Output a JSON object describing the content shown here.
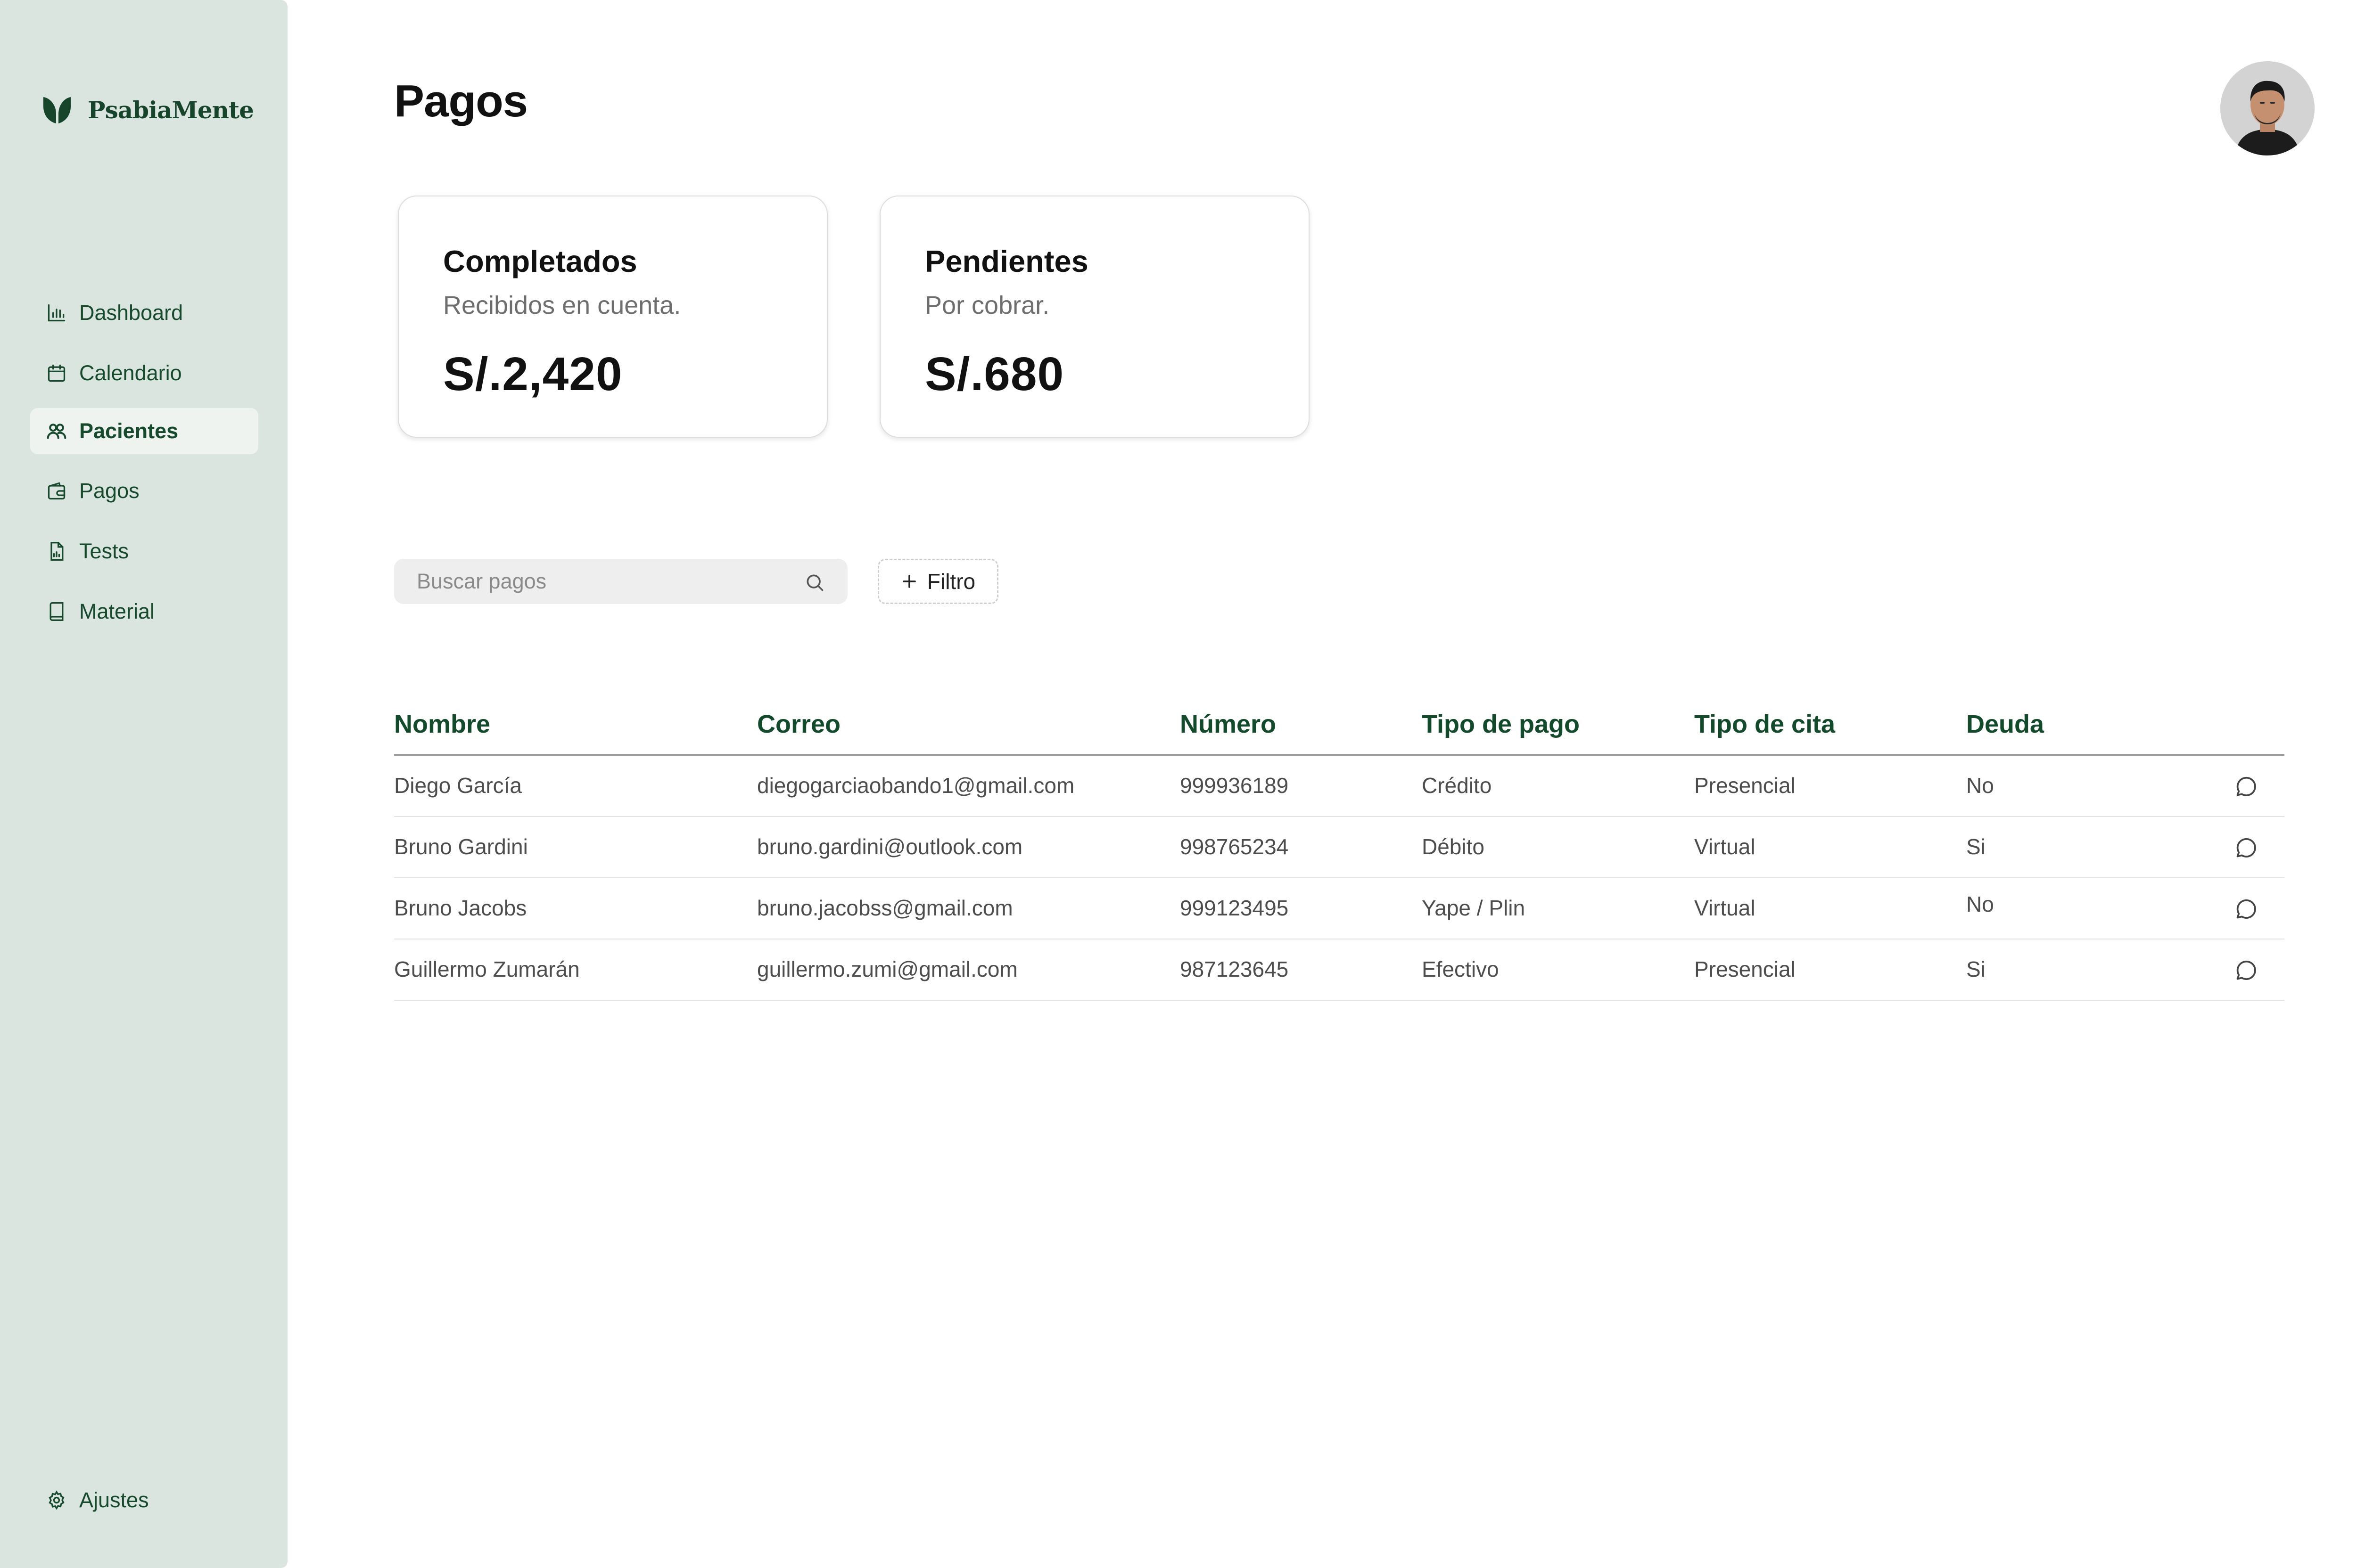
{
  "app": {
    "brand": "PsabiaMente",
    "brand_color": "#17452c",
    "sidebar_bg": "#dbe5df"
  },
  "sidebar": {
    "items": [
      {
        "label": "Dashboard",
        "icon": "bar-chart-icon"
      },
      {
        "label": "Calendario",
        "icon": "calendar-icon"
      },
      {
        "label": "Pacientes",
        "icon": "users-icon",
        "active": true
      },
      {
        "label": "Pagos",
        "icon": "wallet-icon"
      },
      {
        "label": "Tests",
        "icon": "document-chart-icon"
      },
      {
        "label": "Material",
        "icon": "book-icon"
      }
    ],
    "settings": {
      "label": "Ajustes",
      "icon": "gear-icon"
    }
  },
  "page": {
    "title": "Pagos"
  },
  "cards": [
    {
      "title": "Completados",
      "subtitle": "Recibidos en cuenta.",
      "amount": "S/.2,420"
    },
    {
      "title": "Pendientes",
      "subtitle": "Por cobrar.",
      "amount": "S/.680"
    }
  ],
  "search": {
    "placeholder": "Buscar pagos",
    "value": ""
  },
  "filter": {
    "label": "Filtro"
  },
  "table": {
    "headers": [
      "Nombre",
      "Correo",
      "Número",
      "Tipo de pago",
      "Tipo de cita",
      "Deuda"
    ],
    "rows": [
      [
        "Diego García",
        "diegogarciaobando1@gmail.com",
        "999936189",
        "Crédito",
        "Presencial",
        "No"
      ],
      [
        "Bruno Gardini",
        "bruno.gardini@outlook.com",
        "998765234",
        "Débito",
        "Virtual",
        "Si"
      ],
      [
        "Bruno Jacobs",
        "bruno.jacobss@gmail.com",
        "999123495",
        "Yape / Plin",
        "Virtual",
        "No"
      ],
      [
        "Guillermo Zumarán",
        "guillermo.zumi@gmail.com",
        "987123645",
        "Efectivo",
        "Presencial",
        "Si"
      ]
    ]
  }
}
